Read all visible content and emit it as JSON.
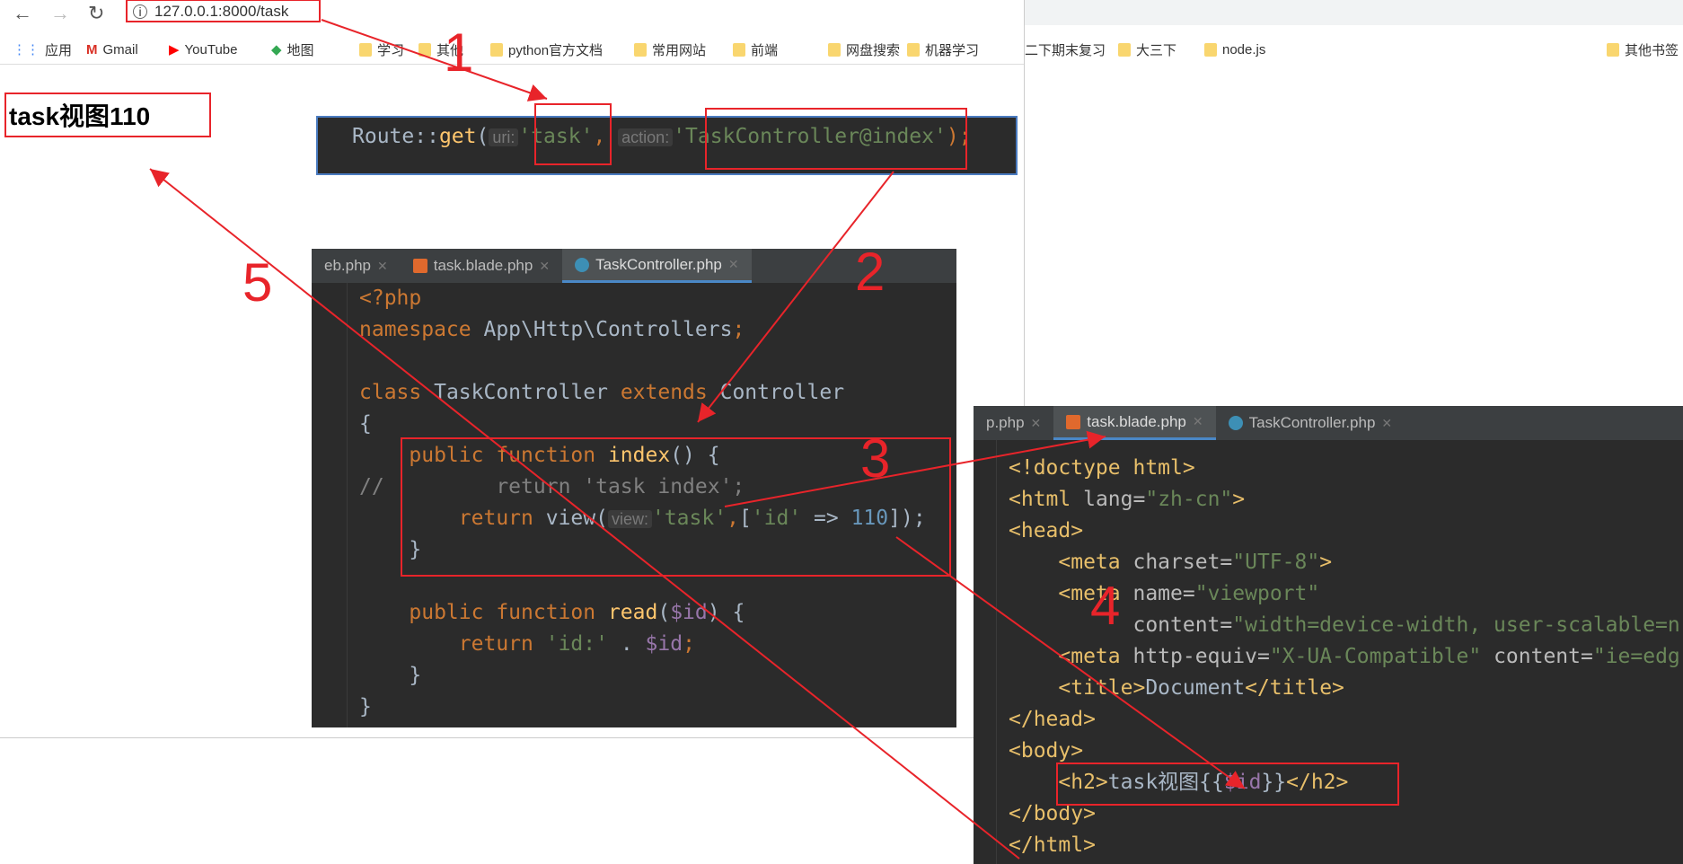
{
  "browser": {
    "url": "127.0.0.1:8000/task",
    "bookmarks": [
      "应用",
      "Gmail",
      "YouTube",
      "地图",
      "学习",
      "其他",
      "python官方文档",
      "常用网站",
      "前端",
      "网盘搜索",
      "机器学习"
    ],
    "right_bookmarks": [
      "二下期末复习",
      "大三下",
      "node.js",
      "其他书签"
    ]
  },
  "page": {
    "heading": "task视图110"
  },
  "route_editor": {
    "lines": [
      [
        [
          "Route::",
          "d"
        ],
        [
          "get",
          "f"
        ],
        [
          "(",
          "d"
        ],
        [
          "uri:",
          "h"
        ],
        [
          "'task'",
          "s"
        ],
        [
          ", ",
          "k"
        ],
        [
          "action:",
          "h"
        ],
        [
          "'TaskController@index'",
          "s"
        ],
        [
          ");",
          "k"
        ]
      ]
    ]
  },
  "controller_editor": {
    "tabs": [
      "eb.php",
      "task.blade.php",
      "TaskController.php"
    ],
    "active_tab": 2,
    "lines": [
      [
        [
          "<?php",
          "k"
        ]
      ],
      [
        [
          "namespace ",
          "k"
        ],
        [
          "App\\Http\\Controllers",
          "d"
        ],
        [
          ";",
          "k"
        ]
      ],
      [],
      [
        [
          "class ",
          "k"
        ],
        [
          "TaskController ",
          "d"
        ],
        [
          "extends ",
          "k"
        ],
        [
          "Controller",
          "d"
        ]
      ],
      [
        [
          "{",
          "d"
        ]
      ],
      [
        [
          "    public function ",
          "k"
        ],
        [
          "index",
          "f"
        ],
        [
          "() {",
          "d"
        ]
      ],
      [
        [
          "//",
          "c"
        ],
        [
          "         return 'task index';",
          "c"
        ]
      ],
      [
        [
          "        return ",
          "k"
        ],
        [
          "view(",
          "d"
        ],
        [
          "view:",
          "h"
        ],
        [
          "'task'",
          "s"
        ],
        [
          ",",
          "k"
        ],
        [
          "[",
          "d"
        ],
        [
          "'id'",
          "s"
        ],
        [
          " => ",
          "d"
        ],
        [
          "110",
          "n"
        ],
        [
          "]);",
          "d"
        ]
      ],
      [
        [
          "    }",
          "d"
        ]
      ],
      [],
      [
        [
          "    public function ",
          "k"
        ],
        [
          "read",
          "f"
        ],
        [
          "(",
          "d"
        ],
        [
          "$id",
          "v"
        ],
        [
          ") {",
          "d"
        ]
      ],
      [
        [
          "        return ",
          "k"
        ],
        [
          "'id:'",
          "s"
        ],
        [
          " . ",
          "d"
        ],
        [
          "$id",
          "v"
        ],
        [
          ";",
          "k"
        ]
      ],
      [
        [
          "    }",
          "d"
        ]
      ],
      [
        [
          "}",
          "d"
        ]
      ]
    ]
  },
  "blade_editor": {
    "tabs": [
      "p.php",
      "task.blade.php",
      "TaskController.php"
    ],
    "active_tab": 1,
    "lines": [
      [
        [
          "<!doctype html>",
          "t"
        ]
      ],
      [
        [
          "<html ",
          "t"
        ],
        [
          "lang=",
          "a"
        ],
        [
          "\"zh-cn\"",
          "s"
        ],
        [
          ">",
          "t"
        ]
      ],
      [
        [
          "<head>",
          "t"
        ]
      ],
      [
        [
          "    <meta ",
          "t"
        ],
        [
          "charset=",
          "a"
        ],
        [
          "\"UTF-8\"",
          "s"
        ],
        [
          ">",
          "t"
        ]
      ],
      [
        [
          "    <meta ",
          "t"
        ],
        [
          "name=",
          "a"
        ],
        [
          "\"viewport\"",
          "s"
        ]
      ],
      [
        [
          "          content=",
          "a"
        ],
        [
          "\"width=device-width, user-scalable=n",
          "s"
        ]
      ],
      [
        [
          "    <meta ",
          "t"
        ],
        [
          "http-equiv=",
          "a"
        ],
        [
          "\"X-UA-Compatible\" ",
          "s"
        ],
        [
          "content=",
          "a"
        ],
        [
          "\"ie=edg",
          "s"
        ]
      ],
      [
        [
          "    <title>",
          "t"
        ],
        [
          "Document",
          "d"
        ],
        [
          "</title>",
          "t"
        ]
      ],
      [
        [
          "</head>",
          "t"
        ]
      ],
      [
        [
          "<body>",
          "t"
        ]
      ],
      [
        [
          "    <h2>",
          "t"
        ],
        [
          "task视图{{",
          "d"
        ],
        [
          "$id",
          "v"
        ],
        [
          "}}",
          "d"
        ],
        [
          "</h2>",
          "t"
        ]
      ],
      [
        [
          "</body>",
          "t"
        ]
      ],
      [
        [
          "</html>",
          "t"
        ]
      ]
    ]
  },
  "annotations": [
    "1",
    "2",
    "3",
    "4",
    "5"
  ],
  "colors": {
    "annotation": "#e8242a",
    "editor_bg": "#2b2b2b",
    "keyword": "#cc7832",
    "string": "#6a8759",
    "number": "#6897bb"
  }
}
